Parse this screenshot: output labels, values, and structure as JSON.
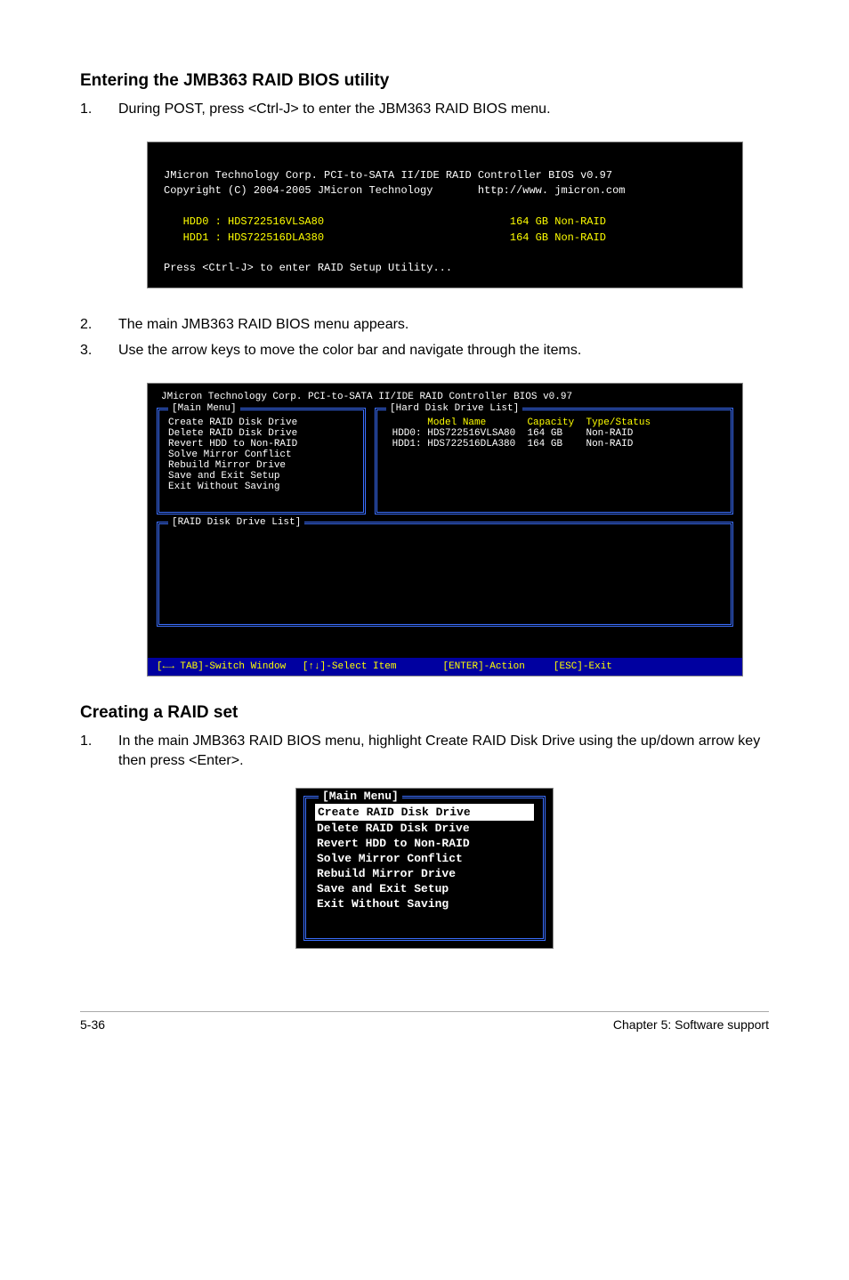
{
  "section1": {
    "heading": "Entering the JMB363 RAID BIOS utility",
    "steps": [
      {
        "num": "1.",
        "text": "During POST, press <Ctrl-J> to enter the JBM363 RAID BIOS menu."
      }
    ]
  },
  "terminal1": {
    "line1": "JMicron Technology Corp. PCI-to-SATA II/IDE RAID Controller BIOS v0.97",
    "line2a": "Copyright (C) 2004-2005 JMicron Technology",
    "line2b": "http://www. jmicron.com",
    "hdd0a": "   HDD0 : HDS722516VLSA80",
    "hdd0b": "164 GB Non-RAID",
    "hdd1a": "   HDD1 : HDS722516DLA380",
    "hdd1b": "164 GB Non-RAID",
    "prompt": "Press <Ctrl-J> to enter RAID Setup Utility..."
  },
  "after_terminal_steps": [
    {
      "num": "2.",
      "text": "The main JMB363 RAID BIOS menu appears."
    },
    {
      "num": "3.",
      "text": "Use the arrow keys to move the color bar and navigate through the items."
    }
  ],
  "bios": {
    "title": "JMicron Technology Corp. PCI-to-SATA II/IDE RAID Controller BIOS v0.97",
    "main_menu_label": "[Main Menu]",
    "drive_list_label": "[Hard Disk Drive List]",
    "raid_list_label": "[RAID Disk Drive List]",
    "menu_items": [
      "Create RAID Disk Drive",
      "Delete RAID Disk Drive",
      "Revert HDD to Non-RAID",
      "Solve Mirror Conflict",
      "Rebuild Mirror Drive",
      "Save and Exit Setup",
      "Exit Without Saving"
    ],
    "drive_header": {
      "model": "Model Name",
      "capacity": "Capacity",
      "type": "Type/Status"
    },
    "drives": [
      {
        "slot": "HDD0:",
        "model": "HDS722516VLSA80",
        "cap": "164 GB",
        "type": "Non-RAID"
      },
      {
        "slot": "HDD1:",
        "model": "HDS722516DLA380",
        "cap": "164 GB",
        "type": "Non-RAID"
      }
    ],
    "footer": {
      "tab_pre": "[",
      "tab_arrows": "←→",
      "tab": " TAB]-Switch Window",
      "select": "[↑↓]-Select Item",
      "action": "[ENTER]-Action",
      "exit": "[ESC]-Exit"
    }
  },
  "section2": {
    "heading": "Creating a RAID set",
    "steps": [
      {
        "num": "1.",
        "text": "In the main JMB363 RAID BIOS menu, highlight Create RAID Disk Drive using the up/down arrow key then press <Enter>."
      }
    ]
  },
  "mainmenu": {
    "label": "[Main Menu]",
    "items": [
      "Create RAID Disk Drive",
      "Delete RAID Disk Drive",
      "Revert HDD to Non-RAID",
      "Solve Mirror Conflict",
      "Rebuild Mirror Drive",
      "Save and Exit Setup",
      "Exit Without Saving"
    ]
  },
  "footer": {
    "page_num": "5-36",
    "chapter": "Chapter 5: Software support"
  }
}
